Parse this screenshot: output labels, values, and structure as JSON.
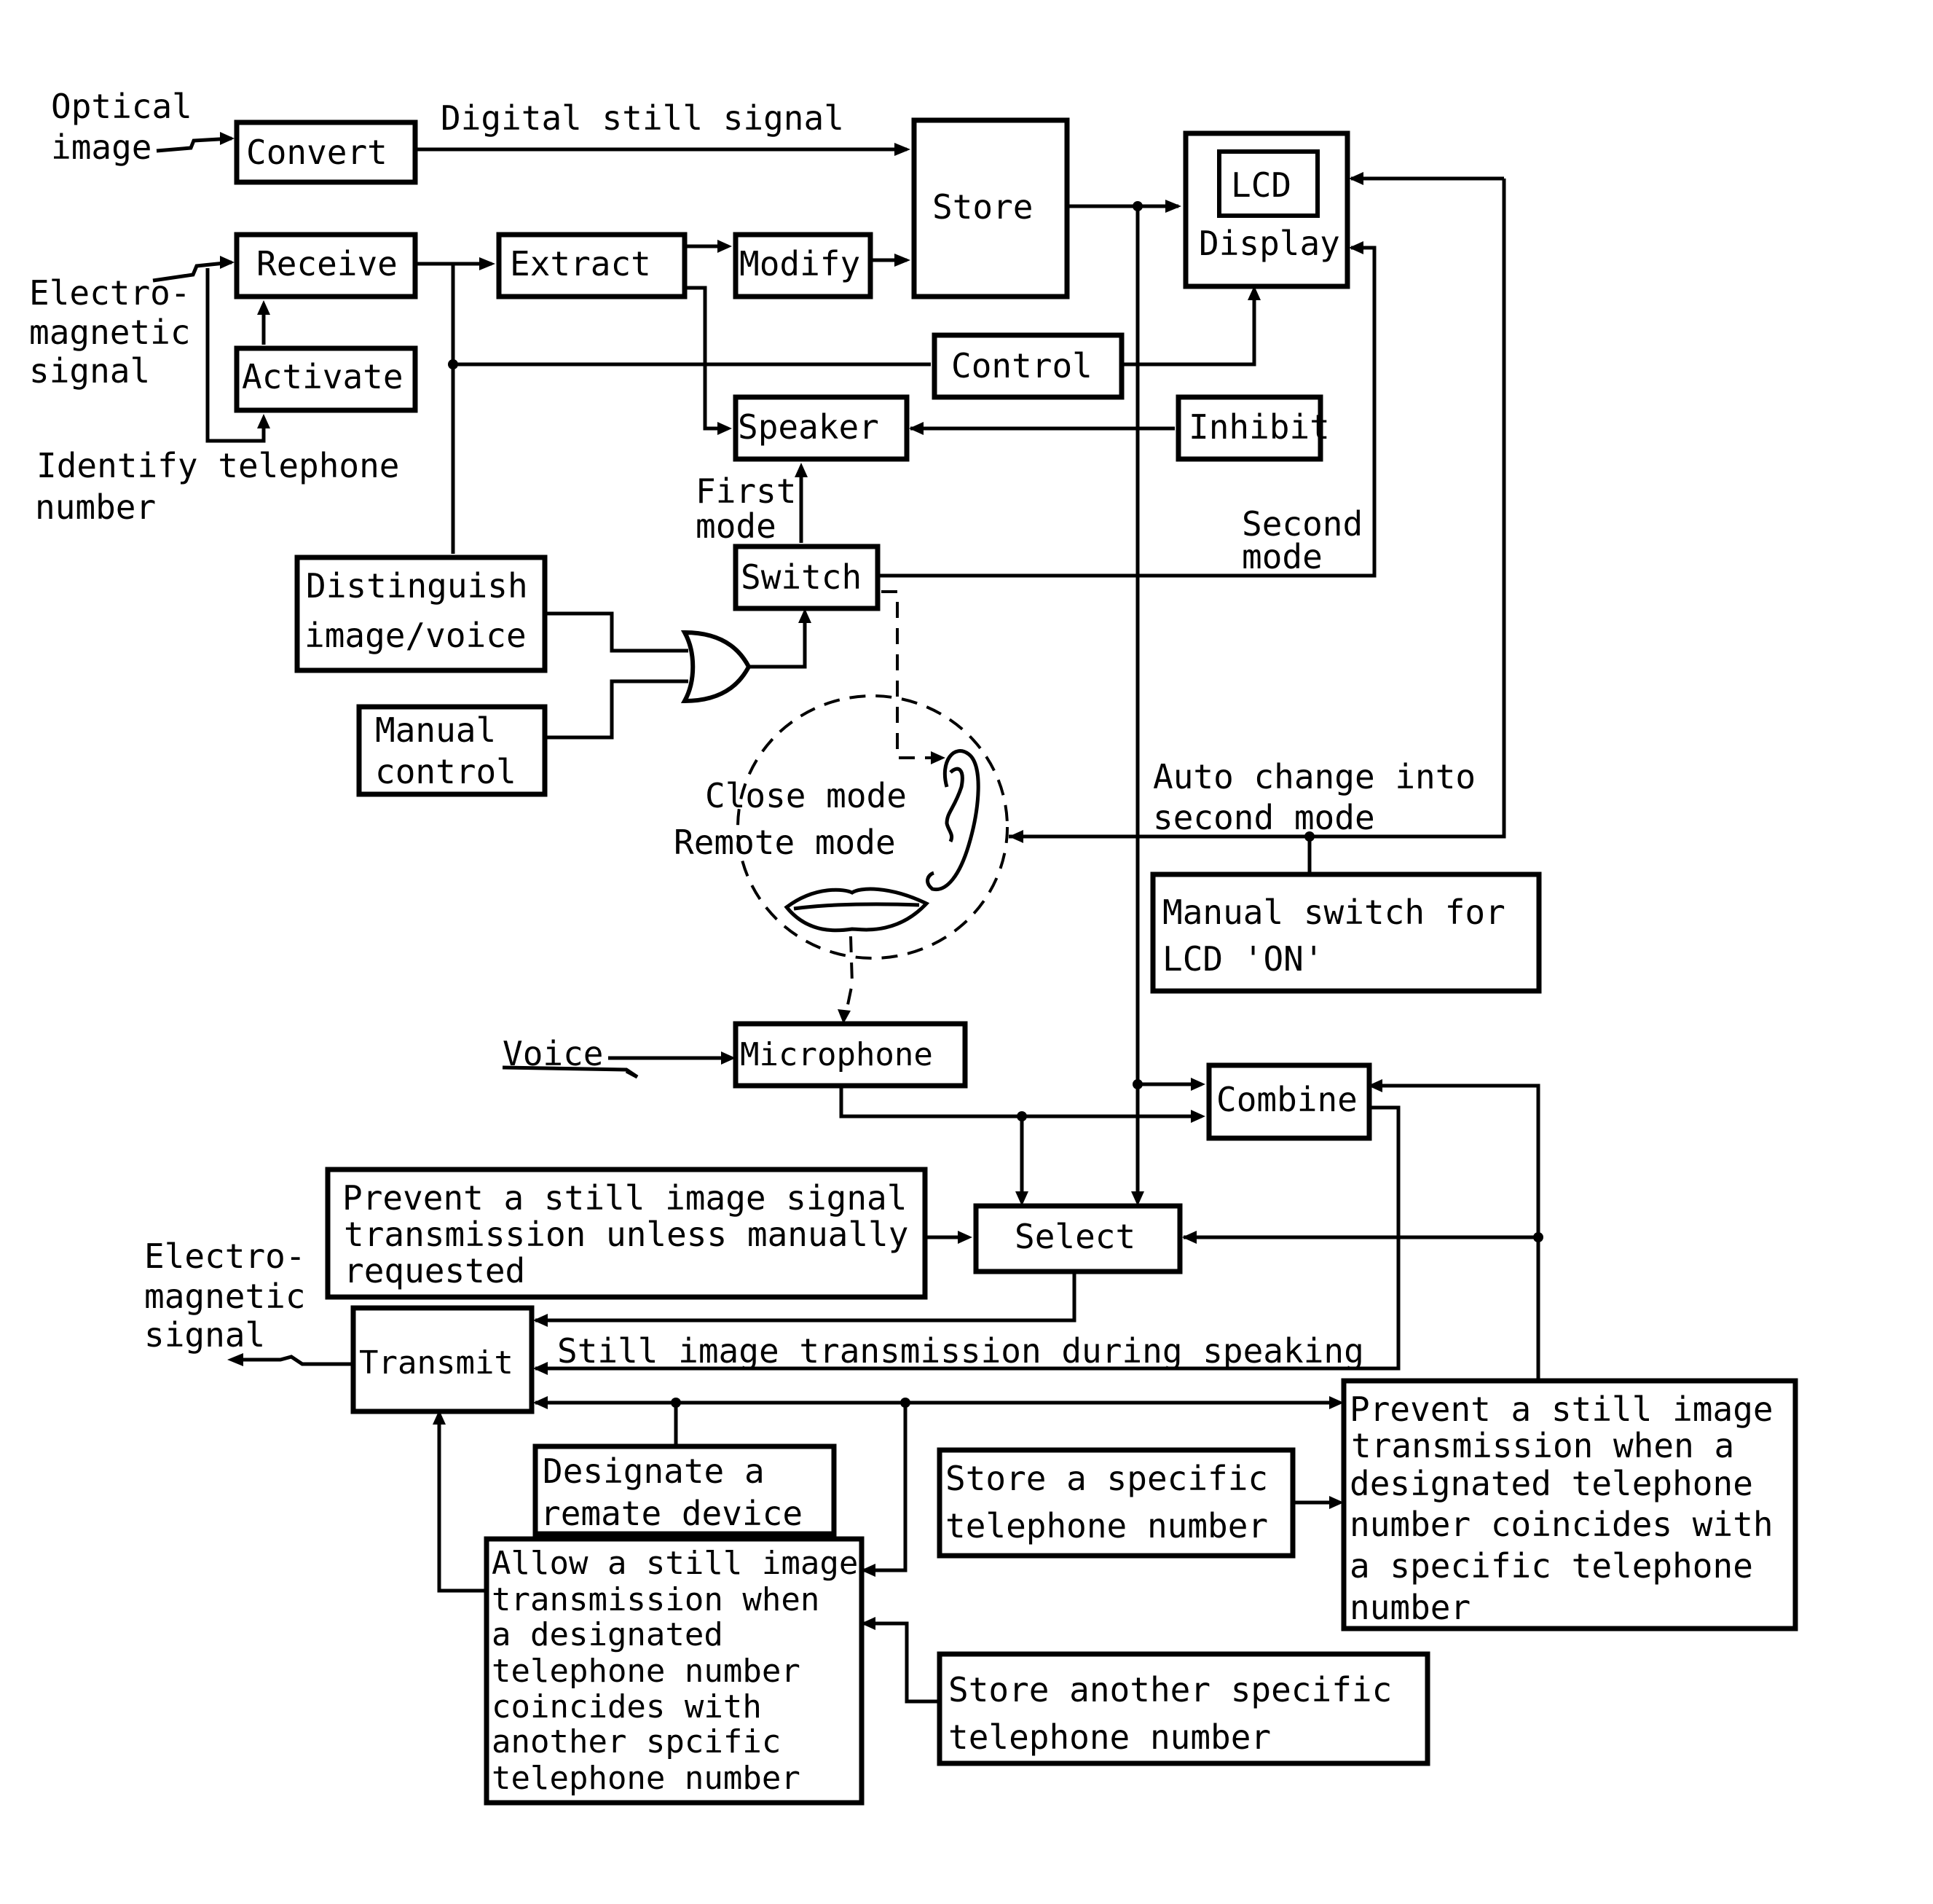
{
  "diagram": {
    "inputs": {
      "optical_image": [
        "Optical",
        "image"
      ],
      "electromagnetic_in": [
        "Electro-",
        "magnetic",
        "signal"
      ],
      "identify_telephone": [
        "Identify telephone",
        "number"
      ],
      "voice": "Voice",
      "electromagnetic_out": [
        "Electro-",
        "magnetic",
        "signal"
      ]
    },
    "edge_labels": {
      "digital_still_signal": "Digital still signal",
      "first_mode": [
        "First",
        "mode"
      ],
      "second_mode": [
        "Second",
        "mode"
      ],
      "auto_change": [
        "Auto change into",
        "second mode"
      ],
      "still_image_during_speaking": "Still image transmission during speaking"
    },
    "blocks": {
      "convert": "Convert",
      "receive": "Receive",
      "activate": "Activate",
      "extract": "Extract",
      "modify": "Modify",
      "store": "Store",
      "lcd": "LCD",
      "display": "Display",
      "control": "Control",
      "speaker": "Speaker",
      "inhibit": "Inhibit",
      "switch": "Switch",
      "distinguish": [
        "Distinguish",
        "image/voice"
      ],
      "manual_control": [
        "Manual",
        "control"
      ],
      "manual_switch_lcd": [
        "Manual switch for",
        "LCD 'ON'"
      ],
      "microphone": "Microphone",
      "combine": "Combine",
      "select": "Select",
      "prevent_unless_manual": [
        "Prevent a still image signal",
        "transmission unless manually",
        "requested"
      ],
      "transmit": "Transmit",
      "designate_remote": [
        "Designate a",
        "remate device"
      ],
      "store_specific": [
        "Store a specific",
        "telephone number"
      ],
      "prevent_when_coincides": [
        "Prevent a still image",
        "transmission when a",
        "designated telephone",
        "number coincides with",
        "a specific telephone",
        "number"
      ],
      "allow_when_coincides": [
        "Allow a still image",
        "transmission when",
        "a designated",
        "telephone number",
        "coincides with",
        "another spcific",
        "telephone number"
      ],
      "store_another": [
        "Store another specific",
        "telephone number"
      ]
    },
    "mode_circle": {
      "close_mode": "Close mode",
      "remote_mode": "Remote mode"
    },
    "gate": "or-gate"
  }
}
